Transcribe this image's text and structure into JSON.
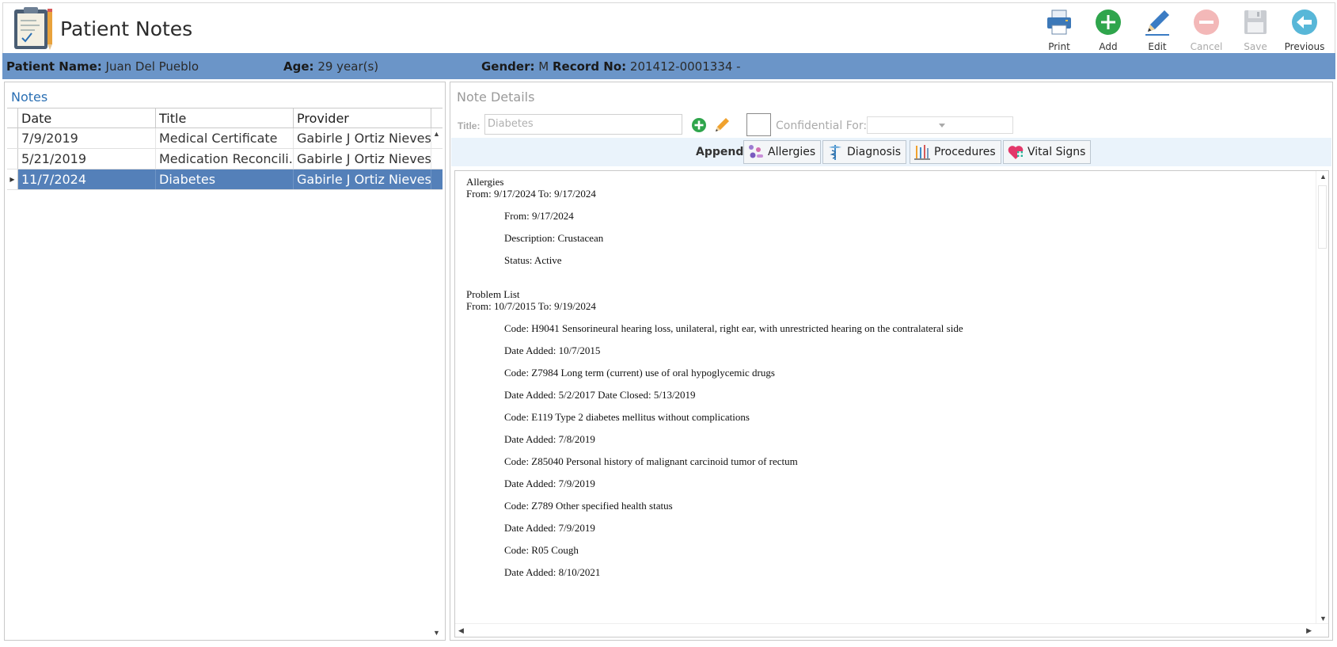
{
  "header": {
    "title": "Patient Notes",
    "toolbar": [
      {
        "label": "Print",
        "icon": "printer-icon",
        "enabled": true
      },
      {
        "label": "Add",
        "icon": "plus-circle-icon",
        "enabled": true
      },
      {
        "label": "Edit",
        "icon": "pencil-icon",
        "enabled": true
      },
      {
        "label": "Cancel",
        "icon": "minus-circle-icon",
        "enabled": false
      },
      {
        "label": "Save",
        "icon": "floppy-disk-icon",
        "enabled": false
      },
      {
        "label": "Previous",
        "icon": "back-arrow-icon",
        "enabled": true
      }
    ]
  },
  "patient": {
    "name_label": "Patient Name:",
    "name": "Juan Del Pueblo",
    "age_label": "Age:",
    "age": "29 year(s)",
    "gender_label": "Gender:",
    "gender": "M",
    "record_label": "Record No:",
    "record": "201412-0001334 -"
  },
  "notes_panel": {
    "title": "Notes",
    "columns": [
      "Date",
      "Title",
      "Provider"
    ],
    "rows": [
      {
        "date": "7/9/2019",
        "title": "Medical Certificate",
        "provider": "Gabirle J Ortiz Nieves",
        "selected": false
      },
      {
        "date": "5/21/2019",
        "title": "Medication Reconcili...",
        "provider": "Gabirle J Ortiz Nieves",
        "selected": false
      },
      {
        "date": "11/7/2024",
        "title": "Diabetes",
        "provider": "Gabirle J Ortiz Nieves",
        "selected": true
      }
    ]
  },
  "details": {
    "title": "Note Details",
    "title_label": "Title:",
    "title_value": "Diabetes",
    "confidential_label": "Confidential For:",
    "confidential_value": "",
    "append_label": "Append:",
    "append_buttons": [
      "Allergies",
      "Diagnosis",
      "Procedures",
      "Vital Signs"
    ]
  },
  "note_text": {
    "allergies_head": "Allergies",
    "allergies_range": "From: 9/17/2024 To: 9/17/2024",
    "allergy_from": "From: 9/17/2024",
    "allergy_desc": "Description: Crustacean",
    "allergy_status": "Status: Active",
    "problems_head": "Problem List",
    "problems_range": "From: 10/7/2015 To: 9/19/2024",
    "p1_code": "Code: H9041 Sensorineural hearing loss, unilateral, right ear, with unrestricted hearing on the contralateral side",
    "p1_date": "Date Added: 10/7/2015",
    "p2_code": "Code: Z7984 Long term (current) use of oral hypoglycemic drugs",
    "p2_date": "Date Added: 5/2/2017 Date Closed: 5/13/2019",
    "p3_code": "Code: E119 Type 2 diabetes mellitus without complications",
    "p3_date": "Date Added: 7/8/2019",
    "p4_code": "Code: Z85040 Personal history of malignant carcinoid tumor of rectum",
    "p4_date": "Date Added: 7/9/2019",
    "p5_code": "Code: Z789 Other specified health status",
    "p5_date": "Date Added: 7/9/2019",
    "p6_code": "Code: R05 Cough",
    "p6_date": "Date Added: 8/10/2021"
  }
}
